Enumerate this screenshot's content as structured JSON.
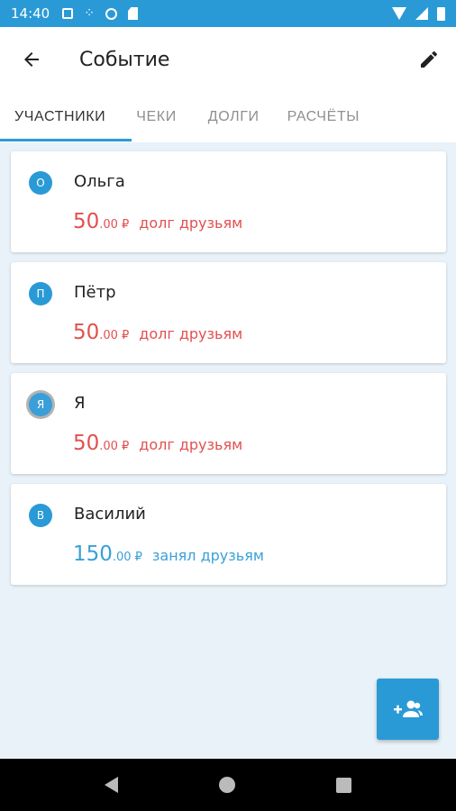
{
  "status_bar": {
    "time": "14:40"
  },
  "app_bar": {
    "title": "Событие"
  },
  "tabs": [
    {
      "label": "УЧАСТНИКИ"
    },
    {
      "label": "ЧЕКИ"
    },
    {
      "label": "ДОЛГИ"
    },
    {
      "label": "РАСЧЁТЫ"
    }
  ],
  "participants": [
    {
      "initial": "О",
      "name": "Ольга",
      "amount_int": "50",
      "amount_dec": ".00",
      "currency": "₽",
      "label": "долг друзьям"
    },
    {
      "initial": "П",
      "name": "Пётр",
      "amount_int": "50",
      "amount_dec": ".00",
      "currency": "₽",
      "label": "долг друзьям"
    },
    {
      "initial": "Я",
      "name": "Я",
      "amount_int": "50",
      "amount_dec": ".00",
      "currency": "₽",
      "label": "долг друзьям"
    },
    {
      "initial": "В",
      "name": "Василий",
      "amount_int": "150",
      "amount_dec": ".00",
      "currency": "₽",
      "label": "занял друзьям"
    }
  ],
  "colors": {
    "accent": "#2a9ad6",
    "debt": "#e2504f",
    "credit": "#3aa0d8",
    "background": "#e9f2f8"
  },
  "icons": {
    "back": "arrow-left-icon",
    "edit": "pencil-icon",
    "fab": "add-people-icon"
  }
}
